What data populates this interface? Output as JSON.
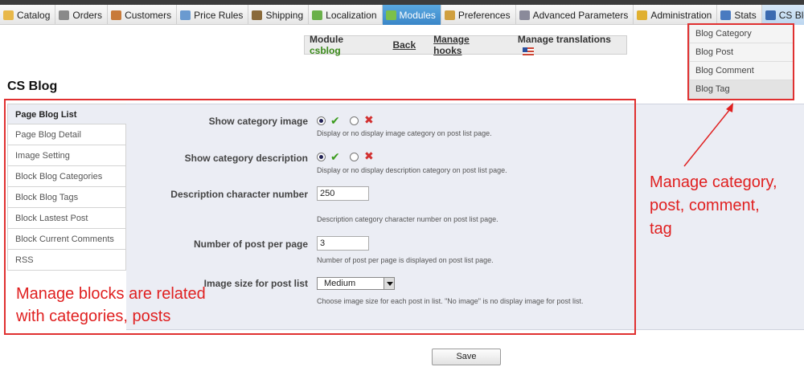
{
  "nav": {
    "tabs": [
      {
        "label": "Catalog",
        "icon": "folder-icon",
        "color": "#e8b84a"
      },
      {
        "label": "Orders",
        "icon": "cart-icon",
        "color": "#8a8a8a"
      },
      {
        "label": "Customers",
        "icon": "user-icon",
        "color": "#c87a3a"
      },
      {
        "label": "Price Rules",
        "icon": "tag-icon",
        "color": "#6a9ad0"
      },
      {
        "label": "Shipping",
        "icon": "truck-icon",
        "color": "#8a6a3a"
      },
      {
        "label": "Localization",
        "icon": "globe-icon",
        "color": "#6ab04a"
      },
      {
        "label": "Modules",
        "icon": "puzzle-icon",
        "color": "#7cc04a"
      },
      {
        "label": "Preferences",
        "icon": "preferences-icon",
        "color": "#d0a040"
      },
      {
        "label": "Advanced Parameters",
        "icon": "wrench-icon",
        "color": "#8a8a9a"
      },
      {
        "label": "Administration",
        "icon": "key-icon",
        "color": "#e0b030"
      },
      {
        "label": "Stats",
        "icon": "chart-icon",
        "color": "#4a7ac0"
      },
      {
        "label": "CS Blog",
        "icon": "book-icon",
        "color": "#3a6ab0"
      }
    ]
  },
  "dropdown": {
    "items": [
      "Blog Category",
      "Blog Post",
      "Blog Comment",
      "Blog Tag"
    ]
  },
  "module_bar": {
    "module_label": "Module",
    "module_name": "csblog",
    "back": "Back",
    "manage_hooks": "Manage hooks",
    "manage_translations": "Manage translations"
  },
  "page_title": "CS Blog",
  "sidebar": {
    "items": [
      "Page Blog List",
      "Page Blog Detail",
      "Image Setting",
      "Block Blog Categories",
      "Block Blog Tags",
      "Block Lastest Post",
      "Block Current Comments",
      "RSS"
    ]
  },
  "form": {
    "show_category_image": {
      "label": "Show category image",
      "help": "Display or no display image category on post list page."
    },
    "show_category_description": {
      "label": "Show category description",
      "help": "Display or no display description category on post list page."
    },
    "description_char_number": {
      "label": "Description character number",
      "value": "250",
      "help": "Description category character number on post list page."
    },
    "posts_per_page": {
      "label": "Number of post per page",
      "value": "3",
      "help": "Number of post per page is displayed on post list page."
    },
    "image_size": {
      "label": "Image size for post list",
      "value": "Medium",
      "help": "Choose image size for each post in list. \"No image\" is no display image for post list."
    },
    "save_label": "Save"
  },
  "annotations": {
    "left": [
      "Manage blocks are related",
      "with categories, posts"
    ],
    "right": [
      "Manage category,",
      "post, comment,",
      "tag"
    ],
    "color": "#e02020"
  }
}
